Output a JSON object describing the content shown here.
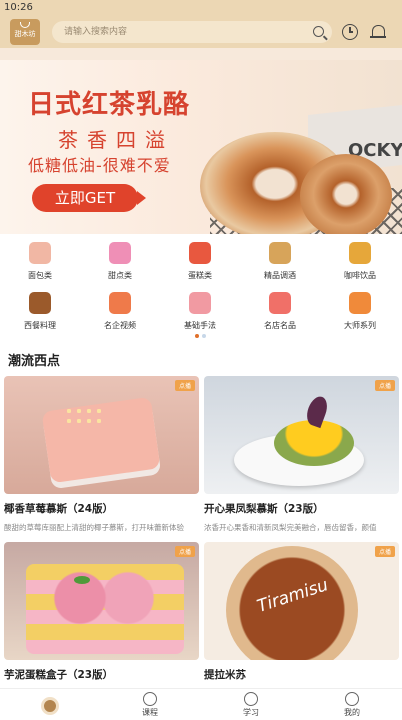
{
  "status_bar": {
    "time": "10:26"
  },
  "header": {
    "logo_text": "甜木坊",
    "search_placeholder": "请输入搜索内容",
    "icons": [
      "search-icon",
      "clock-icon",
      "bell-icon"
    ]
  },
  "banner": {
    "title": "日式红茶乳酪",
    "subtitle": "茶香四溢",
    "tagline": "低糖低油-很难不爱",
    "cta": "立即GET",
    "box_text": "OCKY",
    "slide_count": 5,
    "active_slide": 1
  },
  "categories": [
    {
      "label": "面包类",
      "icon": "bread-icon",
      "color": "#f1b7a4"
    },
    {
      "label": "甜点类",
      "icon": "cupcake-icon",
      "color": "#ef8fb6"
    },
    {
      "label": "蛋糕类",
      "icon": "cake-icon",
      "color": "#e8583f"
    },
    {
      "label": "精品调酒",
      "icon": "cocktail-icon",
      "color": "#d7a45a"
    },
    {
      "label": "咖啡饮品",
      "icon": "coffee-icon",
      "color": "#e6a73a"
    },
    {
      "label": "西餐料理",
      "icon": "dish-icon",
      "color": "#9b5a2b"
    },
    {
      "label": "名企视频",
      "icon": "video-icon",
      "color": "#ef7a4a"
    },
    {
      "label": "基础手法",
      "icon": "rolling-pin-icon",
      "color": "#f19aa2"
    },
    {
      "label": "名店名品",
      "icon": "shop-cake-icon",
      "color": "#f07068"
    },
    {
      "label": "大师系列",
      "icon": "trophy-icon",
      "color": "#f08a3a"
    }
  ],
  "category_pages": {
    "count": 2,
    "active": 0
  },
  "section": {
    "title": "潮流西点"
  },
  "cards": [
    {
      "title": "椰香草莓慕斯（24版）",
      "desc": "酸甜的草莓库丽配上清甜的椰子慕斯，打开味蕾新体验",
      "badge": "点播"
    },
    {
      "title": "开心果凤梨慕斯（23版）",
      "desc": "浓香开心果香和清新凤梨完美融合，唇齿留香，颜值",
      "badge": "点播"
    },
    {
      "title": "芋泥蛋糕盒子（23版）",
      "desc": "",
      "badge": "点播"
    },
    {
      "title": "提拉米苏",
      "desc": "",
      "badge": "点播",
      "img_text": "Tiramisu"
    }
  ],
  "tabbar": [
    {
      "label": "",
      "icon": "home-icon"
    },
    {
      "label": "课程",
      "icon": "course-icon"
    },
    {
      "label": "学习",
      "icon": "play-icon"
    },
    {
      "label": "我的",
      "icon": "profile-icon"
    }
  ]
}
